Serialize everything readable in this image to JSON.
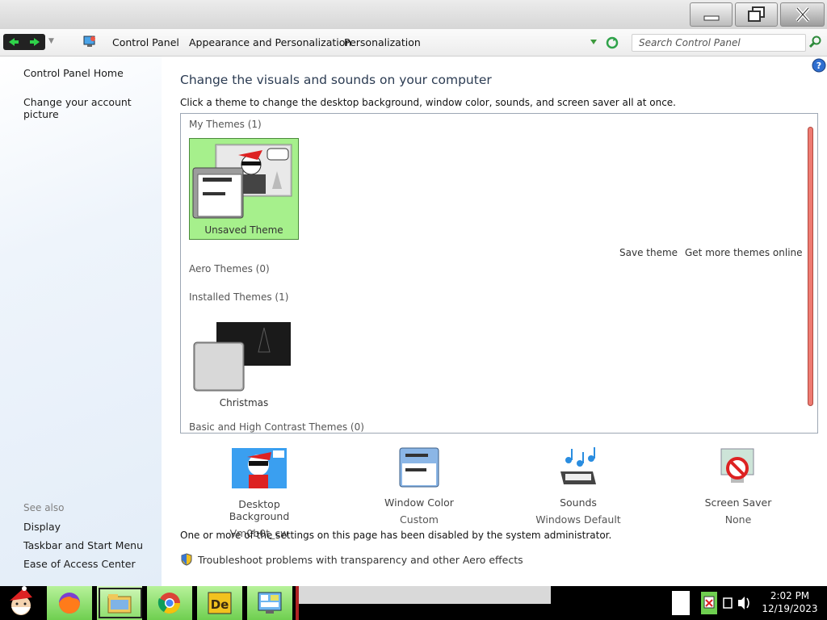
{
  "window": {
    "min_label": "Minimize",
    "max_label": "Restore",
    "close_label": "Close"
  },
  "address": {
    "crumbs": [
      "Control Panel",
      "Appearance and Personalization",
      "Personalization"
    ],
    "search_placeholder": "Search Control Panel"
  },
  "left_pane": {
    "links": [
      "Control Panel Home",
      "Change your account picture"
    ],
    "see_also_label": "See also",
    "see_also": [
      "Display",
      "Taskbar and Start Menu",
      "Ease of Access Center"
    ]
  },
  "main": {
    "heading": "Change the visuals and sounds on your computer",
    "subtext": "Click a theme to change the desktop background, window color, sounds, and screen saver all at once.",
    "groups": {
      "my_themes": "My Themes (1)",
      "aero_themes": "Aero Themes (0)",
      "installed_themes": "Installed Themes (1)",
      "basic_themes": "Basic and High Contrast Themes (0)"
    },
    "themes": {
      "unsaved": "Unsaved Theme",
      "christmas": "Christmas"
    },
    "save_theme": "Save theme",
    "get_more": "Get more themes online",
    "settings": [
      {
        "title": "Desktop Background",
        "value": "Vm0b0t_cw"
      },
      {
        "title": "Window Color",
        "value": "Custom"
      },
      {
        "title": "Sounds",
        "value": "Windows Default"
      },
      {
        "title": "Screen Saver",
        "value": "None"
      }
    ],
    "disabled_note": "One or more of the settings on this page has been disabled by the system administrator.",
    "troubleshoot": "Troubleshoot problems with transparency and other Aero effects"
  },
  "taskbar": {
    "time": "2:02 PM",
    "date": "12/19/2023",
    "apps": [
      "firefox-icon",
      "explorer-icon",
      "chrome-icon",
      "de-icon",
      "control-panel-icon"
    ]
  },
  "colors": {
    "selected_tile": "#a6f08c",
    "scrollbar_thumb": "#ee7b72",
    "taskbar_app": "#8bdc6a",
    "heading": "#2b3b52"
  }
}
